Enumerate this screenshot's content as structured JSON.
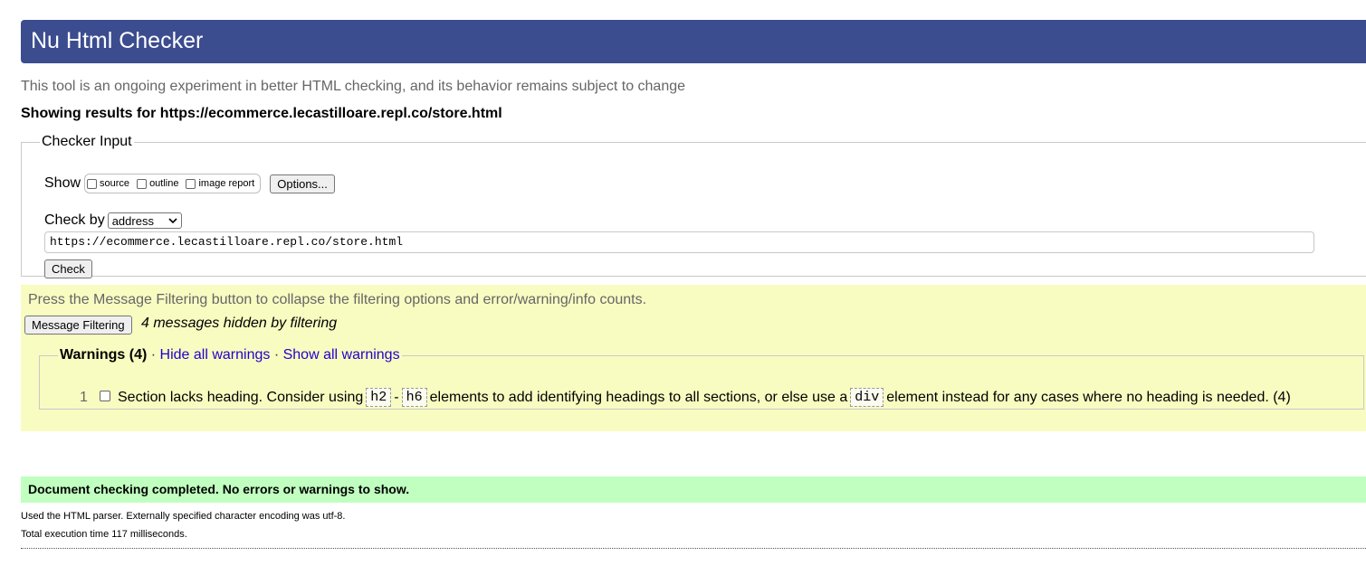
{
  "header": {
    "title": "Nu Html Checker"
  },
  "intro": "This tool is an ongoing experiment in better HTML checking, and its behavior remains subject to change",
  "showing": "Showing results for https://ecommerce.lecastilloare.repl.co/store.html",
  "checker": {
    "legend": "Checker Input",
    "show_label": "Show",
    "show_options": [
      "source",
      "outline",
      "image report"
    ],
    "options_button": "Options...",
    "check_by_label": "Check by",
    "check_by_value": "address",
    "url_value": "https://ecommerce.lecastilloare.repl.co/store.html",
    "check_button": "Check"
  },
  "filtering": {
    "note": "Press the Message Filtering button to collapse the filtering options and error/warning/info counts.",
    "button": "Message Filtering",
    "hidden_text": "4 messages hidden by filtering",
    "warnings_legend": "Warnings (4)",
    "separator": "·",
    "hide_all": "Hide all warnings",
    "show_all": "Show all warnings",
    "warning": {
      "number": "1",
      "text_a": "Section lacks heading. Consider using",
      "code_a": "h2",
      "dash": "-",
      "code_b": "h6",
      "text_b": "elements to add identifying headings to all sections, or else use a",
      "code_c": "div",
      "text_c": "element instead for any cases where no heading is needed. (4)"
    }
  },
  "result": {
    "success": "Document checking completed. No errors or warnings to show.",
    "parser_note": "Used the HTML parser. Externally specified character encoding was utf-8.",
    "time_note": "Total execution time 117 milliseconds."
  },
  "colors": {
    "header_bg": "#3b4c8f",
    "filter_bg": "#f8fcc1",
    "success_bg": "#c0ffc0",
    "link": "#2200cc"
  }
}
